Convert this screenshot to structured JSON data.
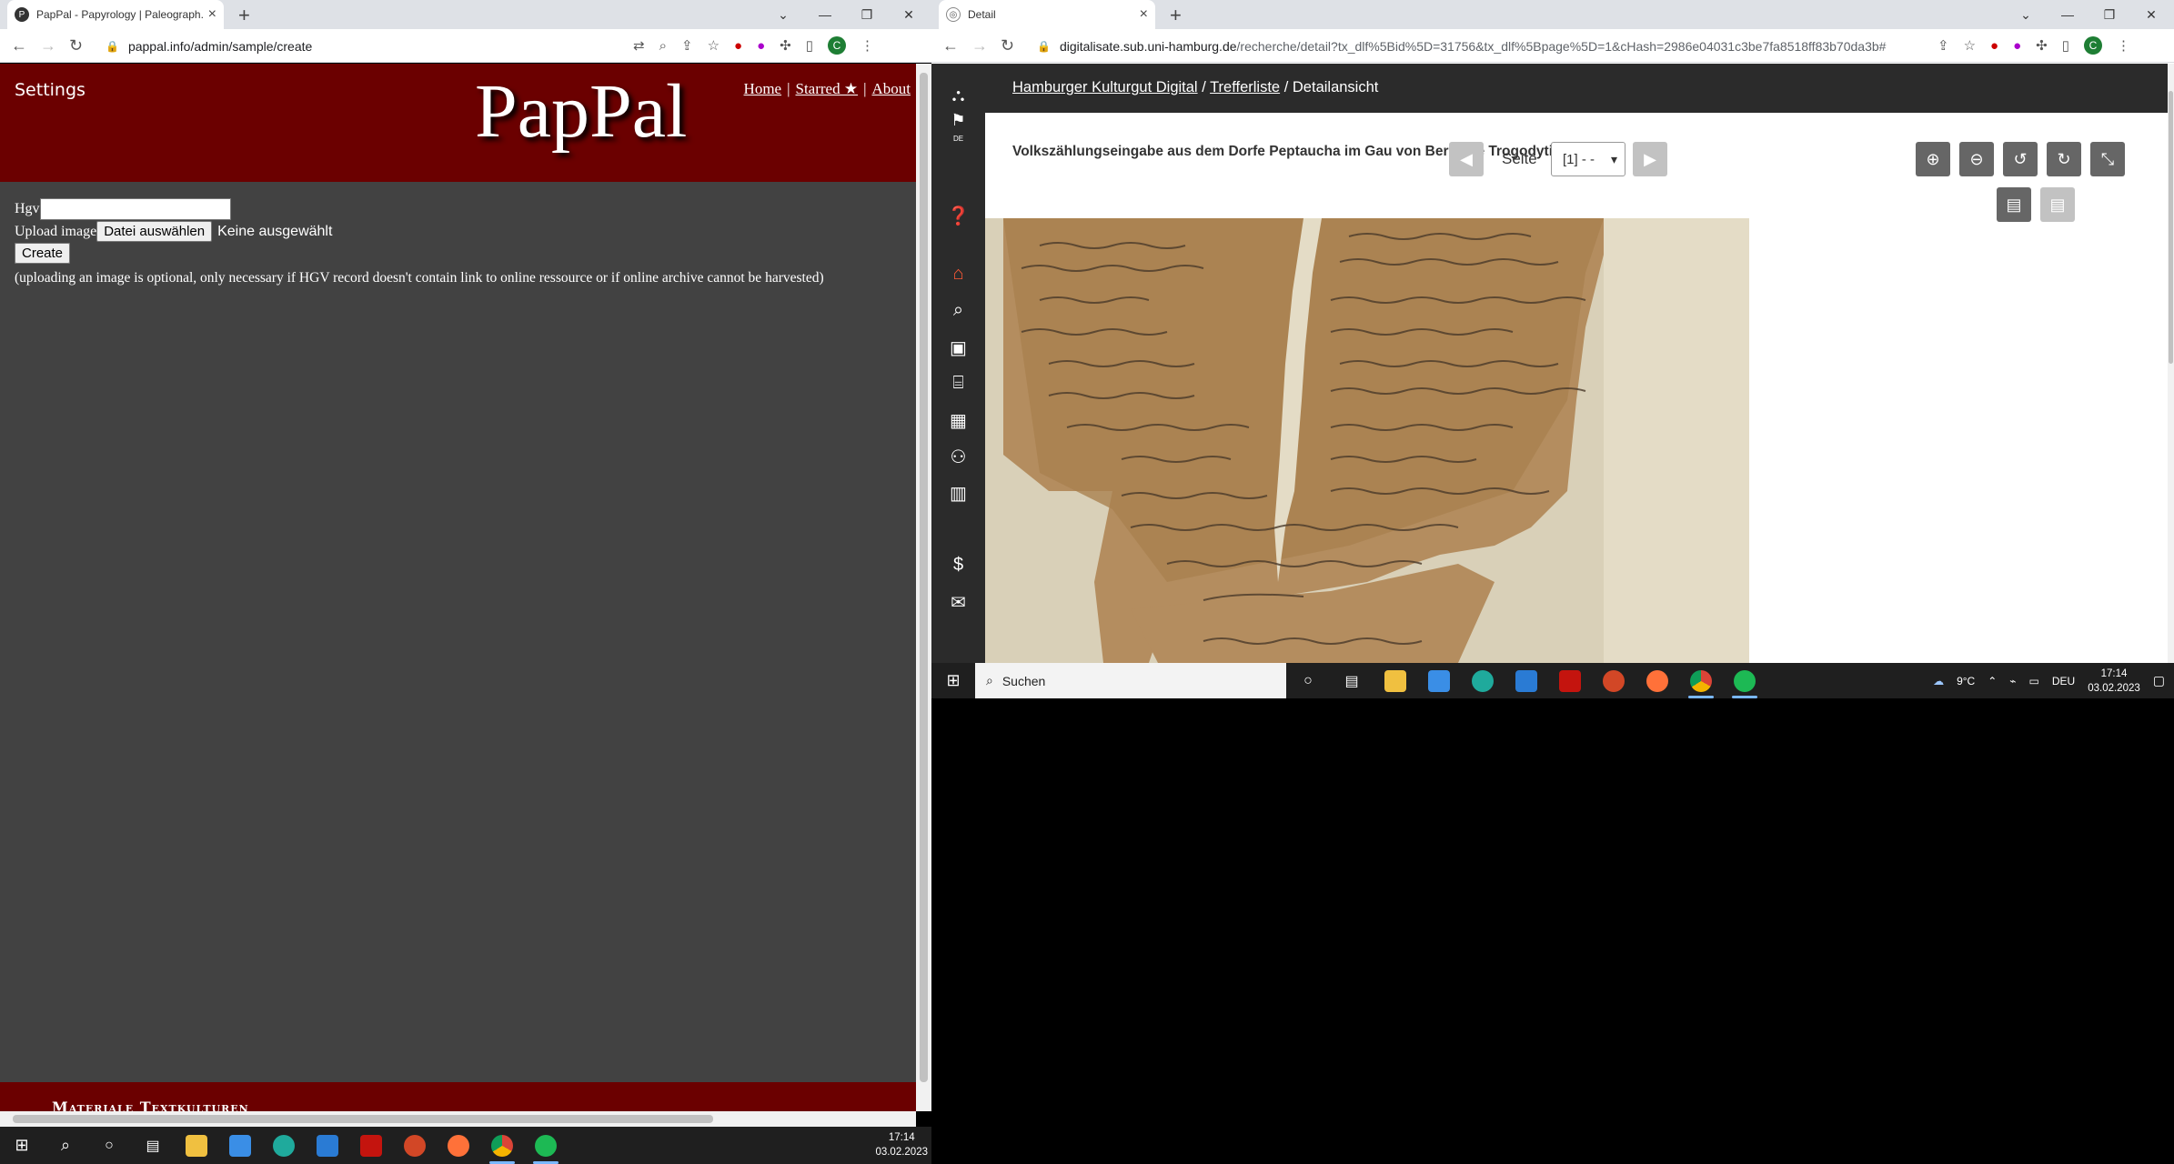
{
  "left_browser": {
    "tab_title": "PapPal - Papyrology | Paleograph...",
    "tab_favicon_letter": "P",
    "url": "pappal.info/admin/sample/create"
  },
  "pappal": {
    "settings_label": "Settings",
    "logo": "PapPal",
    "nav": [
      {
        "label": "Home"
      },
      {
        "label": "Starred ★"
      },
      {
        "label": "About"
      }
    ],
    "nav_sep": "|",
    "form": {
      "hgv_label": "Hgv",
      "hgv_value": "",
      "upload_label": "Upload image",
      "choose_file_button": "Datei auswählen",
      "no_file_text": "Keine ausgewählt",
      "create_button": "Create",
      "note": "(uploading an image is optional, only necessary if HGV record doesn't contain link to online ressource or if online archive cannot be harvested)"
    },
    "footer_text": "Materiale Textkulturen"
  },
  "left_taskbar": {
    "time": "17:14",
    "date": "03.02.2023"
  },
  "right_browser": {
    "tab_title": "Detail",
    "url_host": "digitalisate.sub.uni-hamburg.de",
    "url_path": "/recherche/detail?tx_dlf%5Bid%5D=31756&tx_dlf%5Bpage%5D=1&cHash=2986e04031c3be7fa8518ff83b70da3b#"
  },
  "viewer": {
    "breadcrumb": {
      "home": "Hamburger Kulturgut Digital",
      "sep": "/",
      "results": "Trefferliste",
      "current": "Detailansicht"
    },
    "title": "Volkszählungseingabe aus dem Dorfe Peptaucha im Gau von Berenike Trogodytike",
    "page_label": "Seite",
    "page_select": "[1] - -",
    "sidebar_lang": "DE"
  },
  "right_taskbar": {
    "search_placeholder": "Suchen",
    "weather": "9°C",
    "lang": "DEU",
    "time": "17:14",
    "date": "03.02.2023"
  },
  "colors": {
    "pappal_red": "#6b0000",
    "pappal_body": "#424242",
    "viewer_dark": "#2b2b2b",
    "chrome_tabstrip": "#dee1e6"
  }
}
